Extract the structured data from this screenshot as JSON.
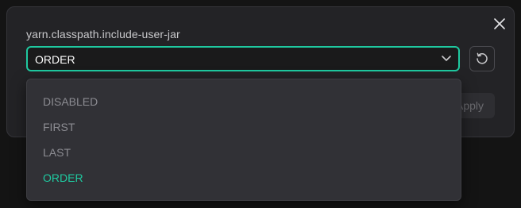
{
  "dialog": {
    "field_label": "yarn.classpath.include-user-jar",
    "select": {
      "value": "ORDER",
      "options": [
        {
          "label": "DISABLED",
          "selected": false
        },
        {
          "label": "FIRST",
          "selected": false
        },
        {
          "label": "LAST",
          "selected": false
        },
        {
          "label": "ORDER",
          "selected": true
        }
      ]
    },
    "apply_label": "Apply"
  },
  "icons": {
    "close": "close-icon",
    "chevron": "chevron-down-icon",
    "reset": "reset-icon"
  },
  "colors": {
    "accent": "#1fc9a0",
    "background": "#141414",
    "dialog": "#232326",
    "dropdown": "#313136",
    "option_text": "#8c8c92"
  }
}
